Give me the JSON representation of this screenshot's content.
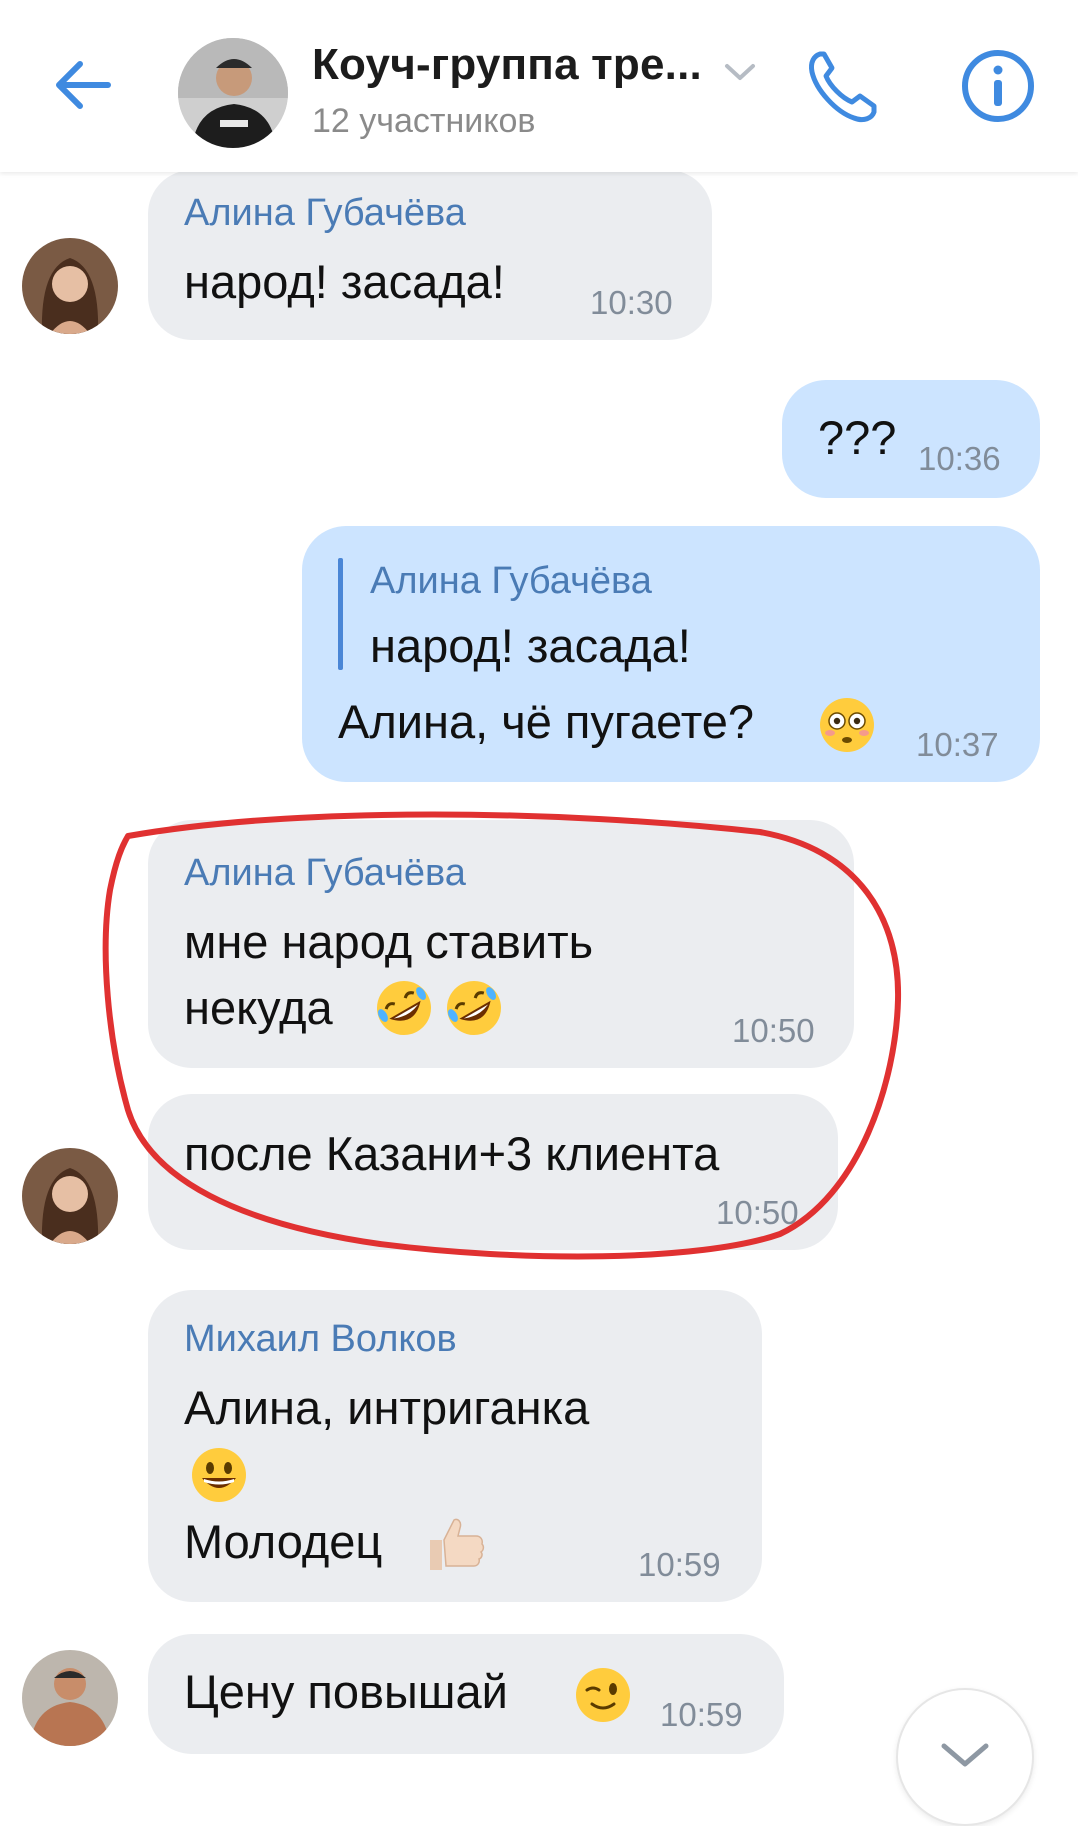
{
  "header": {
    "title": "Коуч-группа тре...",
    "subtitle": "12 участников"
  },
  "messages": [
    {
      "author": "Алина Губачёва",
      "text": "народ! засада!",
      "time": "10:30"
    },
    {
      "text": "???",
      "time": "10:36"
    },
    {
      "reply_author": "Алина Губачёва",
      "reply_text": "народ! засада!",
      "text": "Алина, чё пугаете?",
      "time": "10:37"
    },
    {
      "author": "Алина Губачёва",
      "line1": "мне народ ставить",
      "line2": "некуда",
      "time": "10:50"
    },
    {
      "text": "после Казани+3 клиента",
      "time": "10:50"
    },
    {
      "author": "Михаил Волков",
      "line1": "Алина, интриганка",
      "line3": "Молодец",
      "time": "10:59"
    },
    {
      "text": "Цену повышай",
      "time": "10:59"
    }
  ],
  "colors": {
    "accent": "#3f8ae0",
    "incoming_bubble": "#ebedf0",
    "outgoing_bubble": "#cce4ff",
    "author_name": "#4a7bb5",
    "timestamp": "#818c99",
    "annotation": "#e03131"
  },
  "icons": [
    "back-arrow-icon",
    "chevron-down-icon",
    "phone-icon",
    "info-icon",
    "scroll-down-icon"
  ]
}
